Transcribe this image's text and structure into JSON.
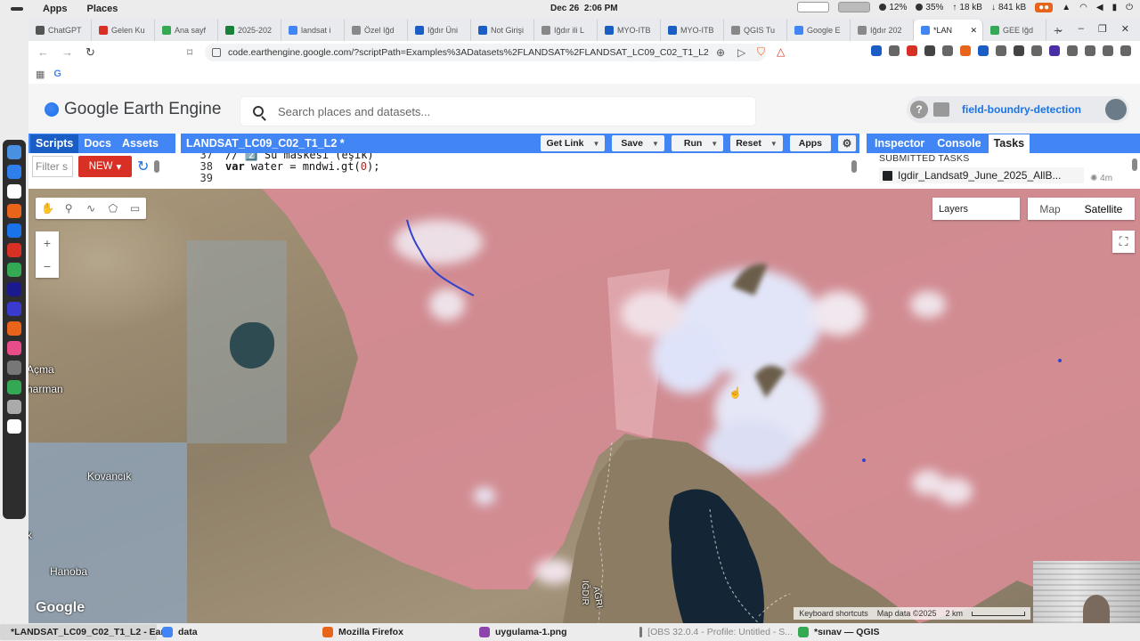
{
  "system": {
    "apps": "Apps",
    "places": "Places",
    "date": "Dec 26",
    "time": "2:06 PM",
    "cpu": "12%",
    "mem": "35%",
    "up": "18 kB",
    "down": "841 kB",
    "badge": "⚡"
  },
  "tabs": [
    {
      "label": "ChatGPT",
      "color": "#555"
    },
    {
      "label": "Gelen Ku",
      "color": "#d93025"
    },
    {
      "label": "Ana sayf",
      "color": "#34a853"
    },
    {
      "label": "2025-202",
      "color": "#188038"
    },
    {
      "label": "landsat i",
      "color": "#4285f4"
    },
    {
      "label": "Özel Iğd",
      "color": "#888"
    },
    {
      "label": "Iğdır Üni",
      "color": "#1a5dc5"
    },
    {
      "label": "Not Girişi",
      "color": "#1a5dc5"
    },
    {
      "label": "Iğdır ili L",
      "color": "#888"
    },
    {
      "label": "MYO-ITB",
      "color": "#1a5dc5"
    },
    {
      "label": "MYO-ITB",
      "color": "#1a5dc5"
    },
    {
      "label": "QGIS Tu",
      "color": "#888"
    },
    {
      "label": "Google E",
      "color": "#4285f4"
    },
    {
      "label": "Iğdır 202",
      "color": "#888"
    },
    {
      "label": "*LAN",
      "color": "#4285f4",
      "active": true
    },
    {
      "label": "GEE Iğd",
      "color": "#34a853"
    }
  ],
  "address": {
    "url": "code.earthengine.google.com/?scriptPath=Examples%3ADatasets%2FLANDSAT%2FLANDSAT_LC09_C02_T1_L2"
  },
  "header": {
    "app_title": "Google Earth Engine",
    "search_placeholder": "Search places and datasets...",
    "project": "field-boundry-detection"
  },
  "left_panel": {
    "tabs": [
      "Scripts",
      "Docs",
      "Assets"
    ],
    "filter_placeholder": "Filter s",
    "new_label": "NEW"
  },
  "editor": {
    "title": "LANDSAT_LC09_C02_T1_L2 *",
    "buttons": {
      "get_link": "Get Link",
      "save": "Save",
      "run": "Run",
      "reset": "Reset",
      "apps": "Apps"
    },
    "lines": [
      {
        "n": "37",
        "code": "// 2️⃣ Su maskesi (eşik)"
      },
      {
        "n": "38",
        "code": "var water = mndwi.gt(0);"
      },
      {
        "n": "39",
        "code": ""
      }
    ]
  },
  "right_panel": {
    "tabs": [
      "Inspector",
      "Console",
      "Tasks"
    ],
    "section": "SUBMITTED TASKS",
    "task_name": "Igdir_Landsat9_June_2025_AllB...",
    "task_time": "4m"
  },
  "map": {
    "tools": [
      "hand-icon",
      "marker-icon",
      "line-icon",
      "polygon-icon",
      "rectangle-icon"
    ],
    "zoom_in": "+",
    "zoom_out": "−",
    "layers_label": "Layers",
    "map_label": "Map",
    "satellite_label": "Satellite",
    "places": [
      {
        "name": "Açma"
      },
      {
        "name": "harman"
      },
      {
        "name": "Kovancık"
      },
      {
        "name": "k"
      },
      {
        "name": "Hanoba"
      },
      {
        "name": "AĞRI"
      },
      {
        "name": "IĞDIR"
      }
    ],
    "google_logo": "Google",
    "attribution": {
      "shortcuts": "Keyboard shortcuts",
      "data": "Map data ©2025",
      "scale": "2 km"
    }
  },
  "taskbar": [
    {
      "label": "*LANDSAT_LC09_C02_T1_L2 - Ear...",
      "color": "#d93025",
      "active": true
    },
    {
      "label": "data",
      "color": "#4285f4"
    },
    {
      "label": "Mozilla Firefox",
      "color": "#e8641b"
    },
    {
      "label": "uygulama-1.png",
      "color": "#8e44ad"
    },
    {
      "label": "[OBS 32.0.4 - Profile: Untitled - S...",
      "color": "#777",
      "dim": true
    },
    {
      "label": "*sınav — QGIS",
      "color": "#34a853"
    }
  ]
}
